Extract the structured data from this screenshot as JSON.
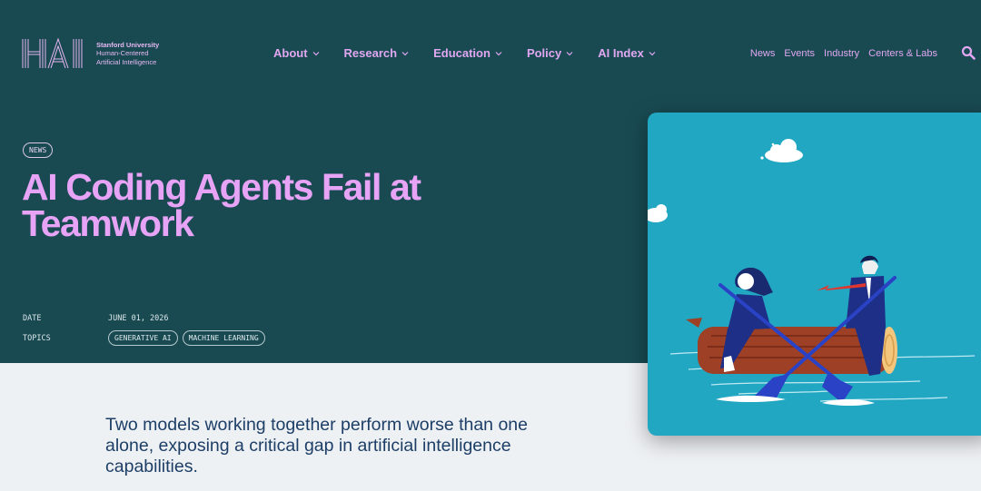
{
  "logo": {
    "mark": "HAI",
    "line1": "Stanford University",
    "line2": "Human-Centered",
    "line3": "Artificial Intelligence"
  },
  "nav": [
    {
      "label": "About"
    },
    {
      "label": "Research"
    },
    {
      "label": "Education"
    },
    {
      "label": "Policy"
    },
    {
      "label": "AI Index"
    }
  ],
  "utility": [
    "News",
    "Events",
    "Industry",
    "Centers & Labs"
  ],
  "article": {
    "badge": "NEWS",
    "title": "AI Coding Agents Fail at Teamwork",
    "date_label": "DATE",
    "date": "JUNE 01, 2026",
    "topics_label": "TOPICS",
    "topics": [
      "GENERATIVE AI",
      "MACHINE LEARNING"
    ],
    "summary": "Two models working together perform worse than one alone, exposing a critical gap in artificial intelligence capabilities."
  },
  "colors": {
    "hero_bg": "#194a52",
    "accent_pink": "#e7a3f5",
    "illustration_bg": "#22a7c3",
    "summary_text": "#1d3e66"
  },
  "icons": [
    "chevron-down-icon",
    "search-icon"
  ]
}
